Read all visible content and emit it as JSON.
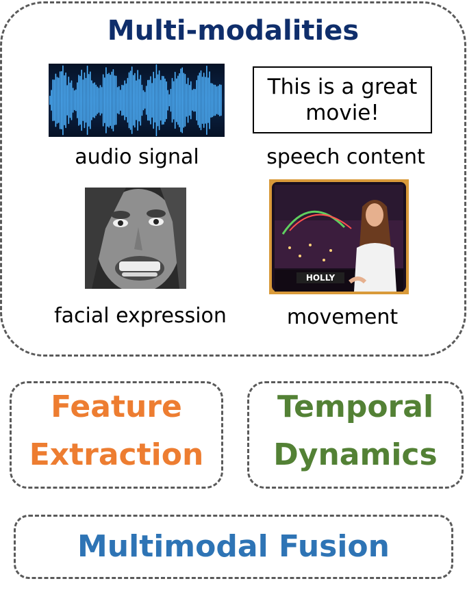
{
  "title": "Multi-modalities",
  "modalities": {
    "audio_caption": "audio signal",
    "speech_caption": "speech content",
    "speech_text": "This is a great movie!",
    "face_caption": "facial expression",
    "movement_caption": "movement",
    "video_nameplate": "HOLLY"
  },
  "blocks": {
    "feature_extraction": [
      "Feature",
      "Extraction"
    ],
    "temporal_dynamics": [
      "Temporal",
      "Dynamics"
    ],
    "multimodal_fusion": "Multimodal Fusion"
  },
  "colors": {
    "title": "#0f2e6b",
    "feature_extraction": "#ed7d31",
    "temporal_dynamics": "#538135",
    "multimodal_fusion": "#2e74b5"
  }
}
